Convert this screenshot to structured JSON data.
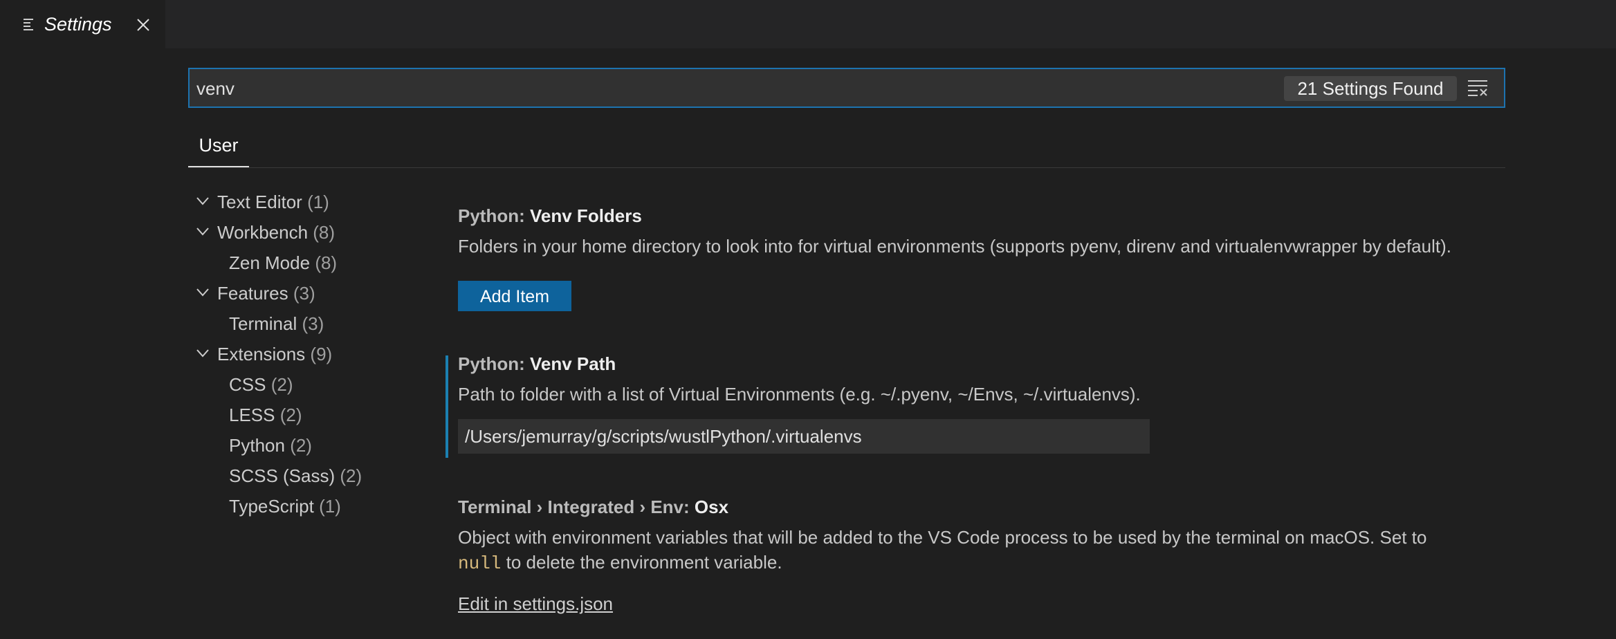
{
  "tab": {
    "title": "Settings"
  },
  "search": {
    "value": "venv",
    "result_count": "21 Settings Found"
  },
  "scope_tabs": [
    {
      "label": "User"
    }
  ],
  "toc": [
    {
      "label": "Text Editor",
      "count": "(1)",
      "expanded": true,
      "level": 0
    },
    {
      "label": "Workbench",
      "count": "(8)",
      "expanded": true,
      "level": 0
    },
    {
      "label": "Zen Mode",
      "count": "(8)",
      "level": 1
    },
    {
      "label": "Features",
      "count": "(3)",
      "expanded": true,
      "level": 0
    },
    {
      "label": "Terminal",
      "count": "(3)",
      "level": 1
    },
    {
      "label": "Extensions",
      "count": "(9)",
      "expanded": true,
      "level": 0
    },
    {
      "label": "CSS",
      "count": "(2)",
      "level": 1
    },
    {
      "label": "LESS",
      "count": "(2)",
      "level": 1
    },
    {
      "label": "Python",
      "count": "(2)",
      "level": 1
    },
    {
      "label": "SCSS (Sass)",
      "count": "(2)",
      "level": 1
    },
    {
      "label": "TypeScript",
      "count": "(1)",
      "level": 1
    }
  ],
  "settings": {
    "venv_folders": {
      "category": "Python: ",
      "name": "Venv Folders",
      "description": "Folders in your home directory to look into for virtual environments (supports pyenv, direnv and virtualenvwrapper by default).",
      "button_label": "Add Item"
    },
    "venv_path": {
      "category": "Python: ",
      "name": "Venv Path",
      "description": "Path to folder with a list of Virtual Environments (e.g. ~/.pyenv, ~/Envs, ~/.virtualenvs).",
      "value": "/Users/jemurray/g/scripts/wustlPython/.virtualenvs"
    },
    "env_osx": {
      "category": "Terminal › Integrated › Env: ",
      "name": "Osx",
      "description_line1": "Object with environment variables that will be added to the VS Code process to be used by the terminal on macOS. Set to",
      "description_code": "null",
      "description_line2": " to delete the environment variable.",
      "link_label": "Edit in settings.json"
    }
  },
  "colors": {
    "accent": "#0e639c",
    "focus_border": "#1d73b0",
    "modified_indicator": "#1b80b2",
    "code": "#d7ba7d"
  },
  "icons": {
    "tab": "settings-lines-icon",
    "close": "close-icon",
    "clear_filter": "clear-filter-icon",
    "chevron": "chevron-down-icon"
  }
}
